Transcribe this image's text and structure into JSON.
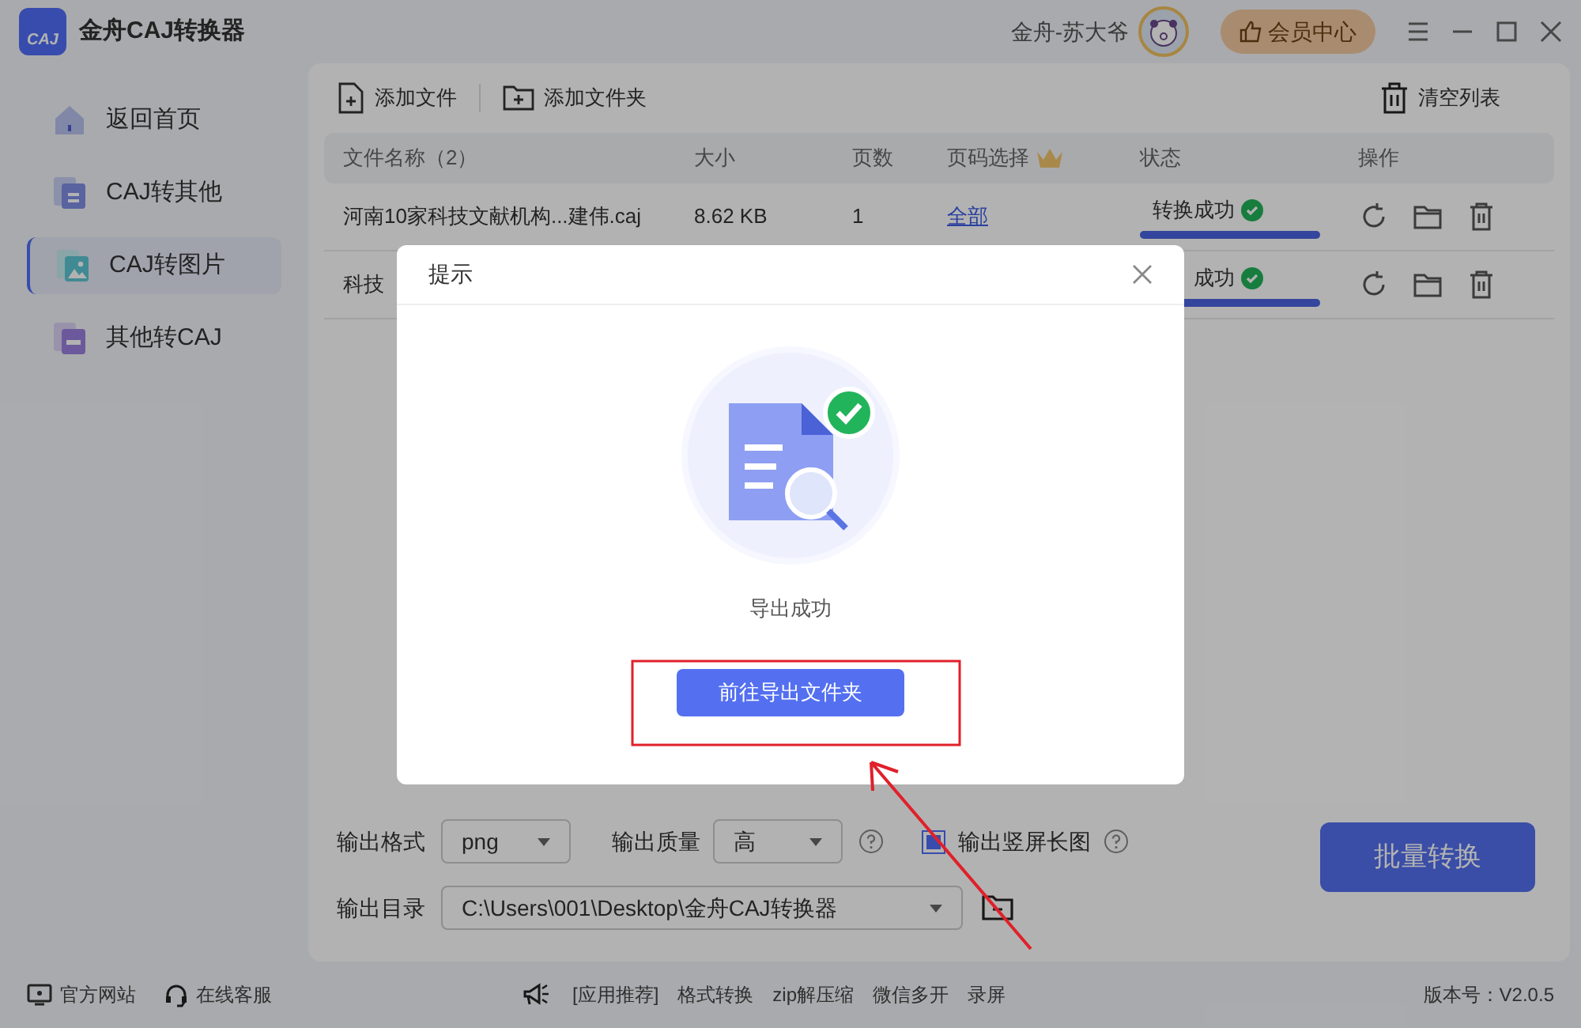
{
  "app": {
    "title": "金舟CAJ转换器",
    "logo_text": "CAJ",
    "user": "金舟-苏大爷",
    "vip_button": "会员中心"
  },
  "sidebar": {
    "items": [
      {
        "label": "返回首页",
        "selected": false
      },
      {
        "label": "CAJ转其他",
        "selected": false
      },
      {
        "label": "CAJ转图片",
        "selected": true
      },
      {
        "label": "其他转CAJ",
        "selected": false
      }
    ]
  },
  "toolbar": {
    "add_file": "添加文件",
    "add_folder": "添加文件夹",
    "clear_list": "清空列表"
  },
  "table": {
    "columns": [
      "文件名称（2）",
      "大小",
      "页数",
      "页码选择",
      "状态",
      "操作"
    ],
    "rows": [
      {
        "name": "河南10家科技文献机构...建伟.caj",
        "size": "8.62 KB",
        "pages": "1",
        "page_select": "全部",
        "status": "转换成功",
        "level": 1
      },
      {
        "name": "科技",
        "size": "",
        "pages": "",
        "page_select": "",
        "status": "成功",
        "level": 1
      }
    ]
  },
  "options": {
    "format_label": "输出格式",
    "format": "png",
    "quality_label": "输出质量",
    "quality": "高",
    "long_image_label": "输出竖屏长图",
    "long_image_checked": true,
    "dir_label": "输出目录",
    "dir": "C:\\Users\\001\\Desktop\\金舟CAJ转换器",
    "convert_button": "批量转换"
  },
  "footer": {
    "website": "官方网站",
    "service": "在线客服",
    "links": [
      "[应用推荐]",
      "格式转换",
      "zip解压缩",
      "微信多开",
      "录屏"
    ],
    "version": "版本号：V2.0.5"
  },
  "dialog": {
    "title": "提示",
    "message": "导出成功",
    "button": "前往导出文件夹"
  }
}
